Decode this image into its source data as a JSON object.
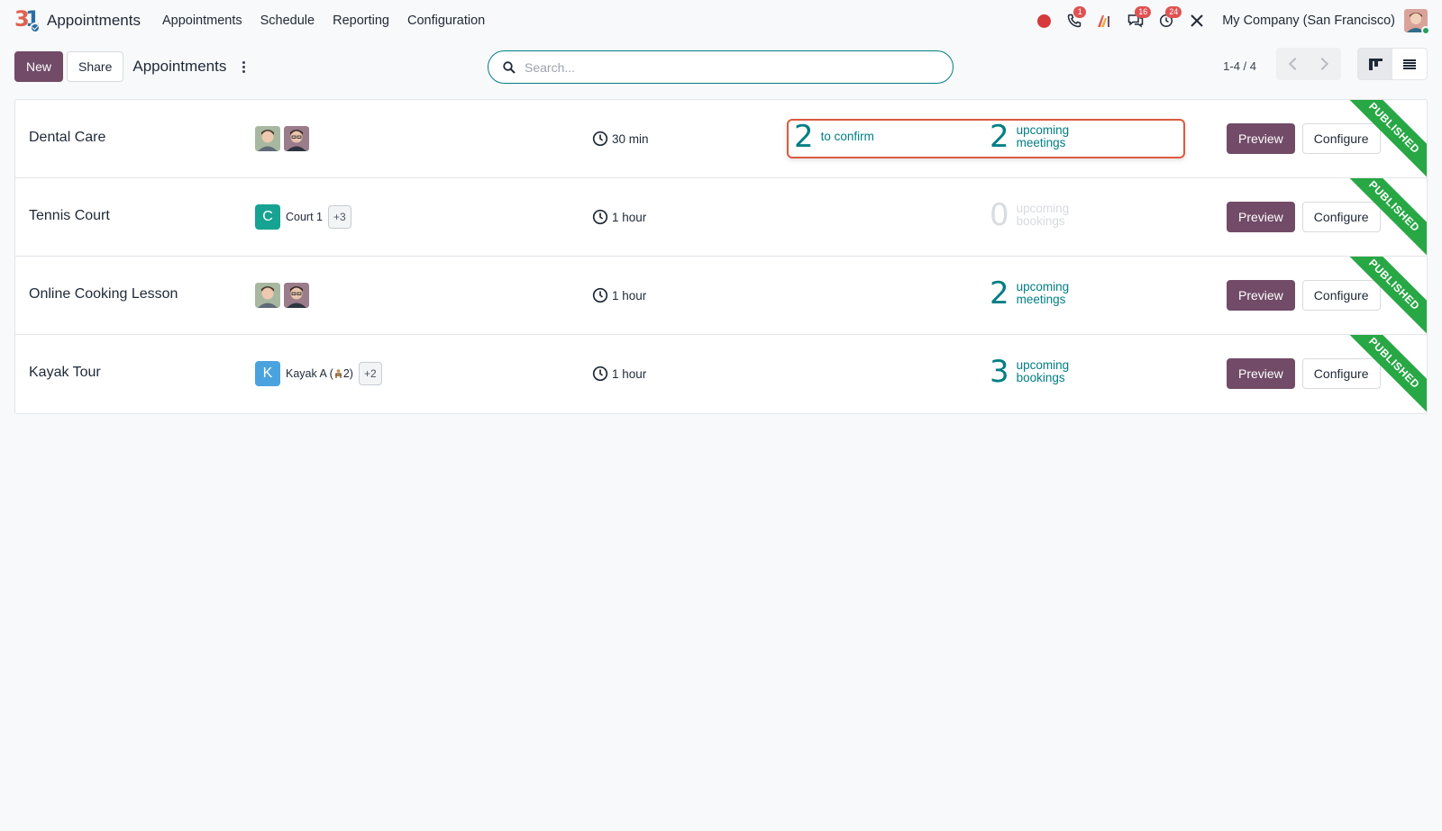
{
  "app": {
    "name": "Appointments",
    "menu": [
      "Appointments",
      "Schedule",
      "Reporting",
      "Configuration"
    ]
  },
  "systray": {
    "phone_badge": "1",
    "messages_badge": "16",
    "activities_badge": "24",
    "company": "My Company (San Francisco)"
  },
  "control_panel": {
    "new_label": "New",
    "share_label": "Share",
    "title": "Appointments",
    "search_placeholder": "Search...",
    "pager": "1-4 / 4"
  },
  "colors": {
    "primary": "#714b67",
    "teal": "#017e84",
    "highlight_border": "#dd5a3f",
    "ribbon": "#28a745"
  },
  "records": [
    {
      "name": "Dental Care",
      "resources": {
        "type": "users",
        "avatars": [
          "person-avatar",
          "person-avatar"
        ]
      },
      "duration": "30 min",
      "stats": [
        {
          "num": "2",
          "label": "to confirm"
        },
        {
          "num": "2",
          "label": "upcoming meetings"
        }
      ],
      "highlighted": true,
      "preview": "Preview",
      "configure": "Configure",
      "ribbon": "PUBLISHED"
    },
    {
      "name": "Tennis Court",
      "resources": {
        "type": "resource",
        "initial": "C",
        "color": "#17a391",
        "label": "Court 1",
        "more": "+3"
      },
      "duration": "1 hour",
      "stats": [
        {
          "num": "0",
          "label": "upcoming bookings",
          "muted": true
        }
      ],
      "preview": "Preview",
      "configure": "Configure",
      "ribbon": "PUBLISHED"
    },
    {
      "name": "Online Cooking Lesson",
      "resources": {
        "type": "users",
        "avatars": [
          "person-avatar",
          "person-avatar"
        ]
      },
      "duration": "1 hour",
      "stats": [
        {
          "num": "2",
          "label": "upcoming meetings"
        }
      ],
      "preview": "Preview",
      "configure": "Configure",
      "ribbon": "PUBLISHED"
    },
    {
      "name": "Kayak Tour",
      "resources": {
        "type": "resource",
        "initial": "K",
        "color": "#4aa3df",
        "label_prefix": "Kayak A (",
        "label_suffix": "2)",
        "more": "+2"
      },
      "duration": "1 hour",
      "stats": [
        {
          "num": "3",
          "label": "upcoming bookings"
        }
      ],
      "preview": "Preview",
      "configure": "Configure",
      "ribbon": "PUBLISHED"
    }
  ]
}
